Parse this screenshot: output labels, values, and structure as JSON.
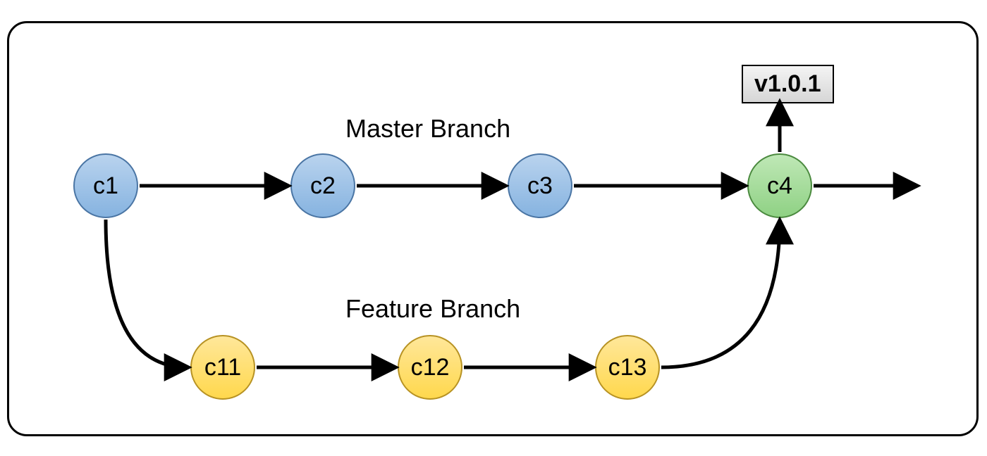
{
  "tag": {
    "label": "v1.0.1"
  },
  "master": {
    "label": "Master Branch",
    "commits": [
      {
        "id": "c1",
        "label": "c1",
        "color": "blue"
      },
      {
        "id": "c2",
        "label": "c2",
        "color": "blue"
      },
      {
        "id": "c3",
        "label": "c3",
        "color": "blue"
      },
      {
        "id": "c4",
        "label": "c4",
        "color": "green"
      }
    ]
  },
  "feature": {
    "label": "Feature Branch",
    "commits": [
      {
        "id": "c11",
        "label": "c11",
        "color": "gold"
      },
      {
        "id": "c12",
        "label": "c12",
        "color": "gold"
      },
      {
        "id": "c13",
        "label": "c13",
        "color": "gold"
      }
    ]
  },
  "edges": [
    {
      "from": "c1",
      "to": "c2",
      "kind": "straight"
    },
    {
      "from": "c2",
      "to": "c3",
      "kind": "straight"
    },
    {
      "from": "c3",
      "to": "c4",
      "kind": "straight"
    },
    {
      "from": "c4",
      "to": "out",
      "kind": "straight"
    },
    {
      "from": "c11",
      "to": "c12",
      "kind": "straight"
    },
    {
      "from": "c12",
      "to": "c13",
      "kind": "straight"
    },
    {
      "from": "c1",
      "to": "c11",
      "kind": "curve-down"
    },
    {
      "from": "c13",
      "to": "c4",
      "kind": "curve-up"
    },
    {
      "from": "c4",
      "to": "tag",
      "kind": "up"
    }
  ]
}
